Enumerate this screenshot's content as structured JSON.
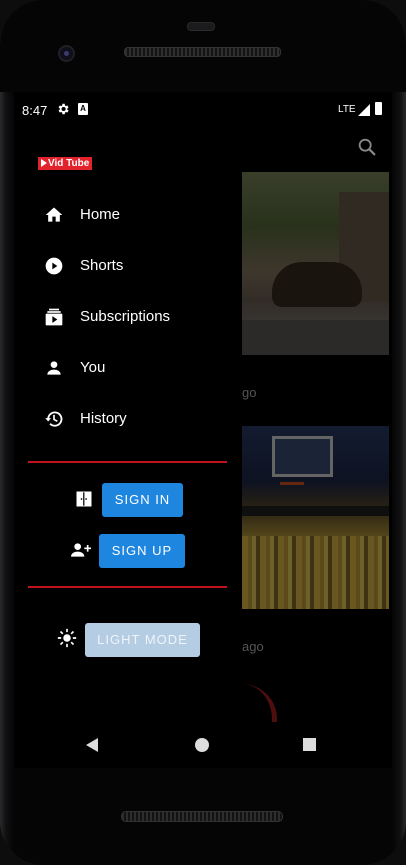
{
  "status_bar": {
    "time": "8:47",
    "network": "LTE",
    "icons": [
      "gear-icon",
      "a-icon",
      "signal-icon",
      "battery-icon"
    ]
  },
  "app": {
    "logo_text": "Vid Tube",
    "brand_color": "#e3232b"
  },
  "drawer": {
    "nav_items": [
      {
        "label": "Home",
        "icon": "home-icon"
      },
      {
        "label": "Shorts",
        "icon": "play-circle-icon"
      },
      {
        "label": "Subscriptions",
        "icon": "subscriptions-icon"
      },
      {
        "label": "You",
        "icon": "person-icon"
      },
      {
        "label": "History",
        "icon": "history-icon"
      }
    ],
    "sign_in_label": "SIGN IN",
    "sign_up_label": "SIGN UP",
    "light_mode_label": "LIGHT MODE",
    "divider_color": "#c1121f",
    "accent_color": "#1f86e0"
  },
  "background_feed": {
    "video_1_age_fragment": "go",
    "video_2_age_fragment": "ago"
  },
  "system_nav": {
    "buttons": [
      "back-icon",
      "home-circle-icon",
      "recents-icon"
    ]
  }
}
